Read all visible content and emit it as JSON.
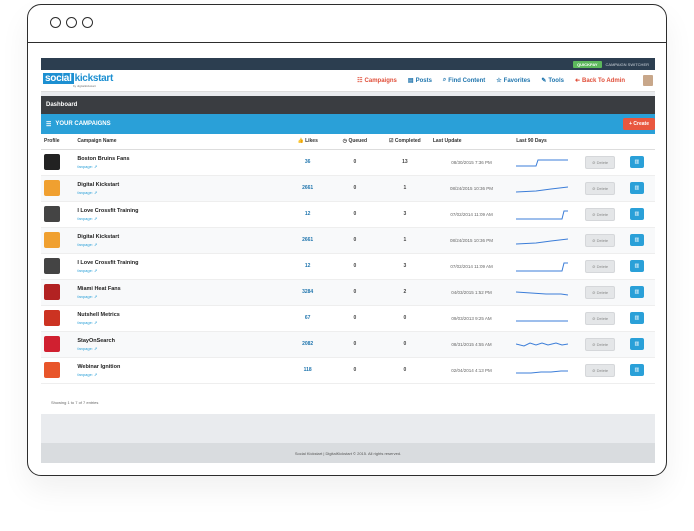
{
  "topbar": {
    "quickpay": "QUICKPAY",
    "switcher": "CAMPAIGN SWITCHER"
  },
  "logo": {
    "social": "social",
    "kickstart": "kickstart",
    "sub": "by digitalkickstart"
  },
  "nav": [
    {
      "label": "Campaigns",
      "icon": "list-icon",
      "color": "red"
    },
    {
      "label": "Posts",
      "icon": "chart-icon",
      "color": "blue"
    },
    {
      "label": "Find Content",
      "icon": "search-icon",
      "color": "blue"
    },
    {
      "label": "Favorites",
      "icon": "star-icon",
      "color": "blue"
    },
    {
      "label": "Tools",
      "icon": "wrench-icon",
      "color": "blue"
    },
    {
      "label": "Back To Admin",
      "icon": "arrow-left-icon",
      "color": "red"
    }
  ],
  "dashboard": {
    "title": "Dashboard"
  },
  "campaigns_bar": {
    "title": "YOUR CAMPAIGNS",
    "create_label": "+ Create"
  },
  "table": {
    "headers": [
      "Profile",
      "Campaign Name",
      "Likes",
      "Queued",
      "Completed",
      "Last Update",
      "Last 90 Days",
      "",
      ""
    ],
    "fanpage_label": "fanpage:",
    "delete_label": "Delete",
    "rows": [
      {
        "name": "Boston Bruins Fans",
        "likes": "36",
        "queued": "0",
        "completed": "13",
        "updated": "08/30/2015 7:36 PM",
        "thumb": "#222222"
      },
      {
        "name": "Digital Kickstart",
        "likes": "2661",
        "queued": "0",
        "completed": "1",
        "updated": "08/24/2015 10:36 PM",
        "thumb": "#f0a030"
      },
      {
        "name": "I Love Crossfit Training",
        "likes": "12",
        "queued": "0",
        "completed": "3",
        "updated": "07/02/2014 11:09 AM",
        "thumb": "#444444"
      },
      {
        "name": "Digital Kickstart",
        "likes": "2661",
        "queued": "0",
        "completed": "1",
        "updated": "08/24/2015 10:36 PM",
        "thumb": "#f0a030"
      },
      {
        "name": "I Love Crossfit Training",
        "likes": "12",
        "queued": "0",
        "completed": "3",
        "updated": "07/02/2014 11:09 AM",
        "thumb": "#444444"
      },
      {
        "name": "Miami Heat Fans",
        "likes": "3284",
        "queued": "0",
        "completed": "2",
        "updated": "04/03/2015 1:52 PM",
        "thumb": "#b22222"
      },
      {
        "name": "Nutshell Metrics",
        "likes": "67",
        "queued": "0",
        "completed": "0",
        "updated": "09/03/2013 9:25 AM",
        "thumb": "#cc3322"
      },
      {
        "name": "StayOnSearch",
        "likes": "2082",
        "queued": "0",
        "completed": "0",
        "updated": "08/31/2015 4:55 AM",
        "thumb": "#d02030"
      },
      {
        "name": "Webinar Ignition",
        "likes": "118",
        "queued": "0",
        "completed": "0",
        "updated": "02/04/2014 4:13 PM",
        "thumb": "#e8552a"
      }
    ]
  },
  "showing": "Showing 1 to 7 of 7 entries",
  "footer": "Social Kickstart | DigitalKickstart © 2015. All rights reserved."
}
